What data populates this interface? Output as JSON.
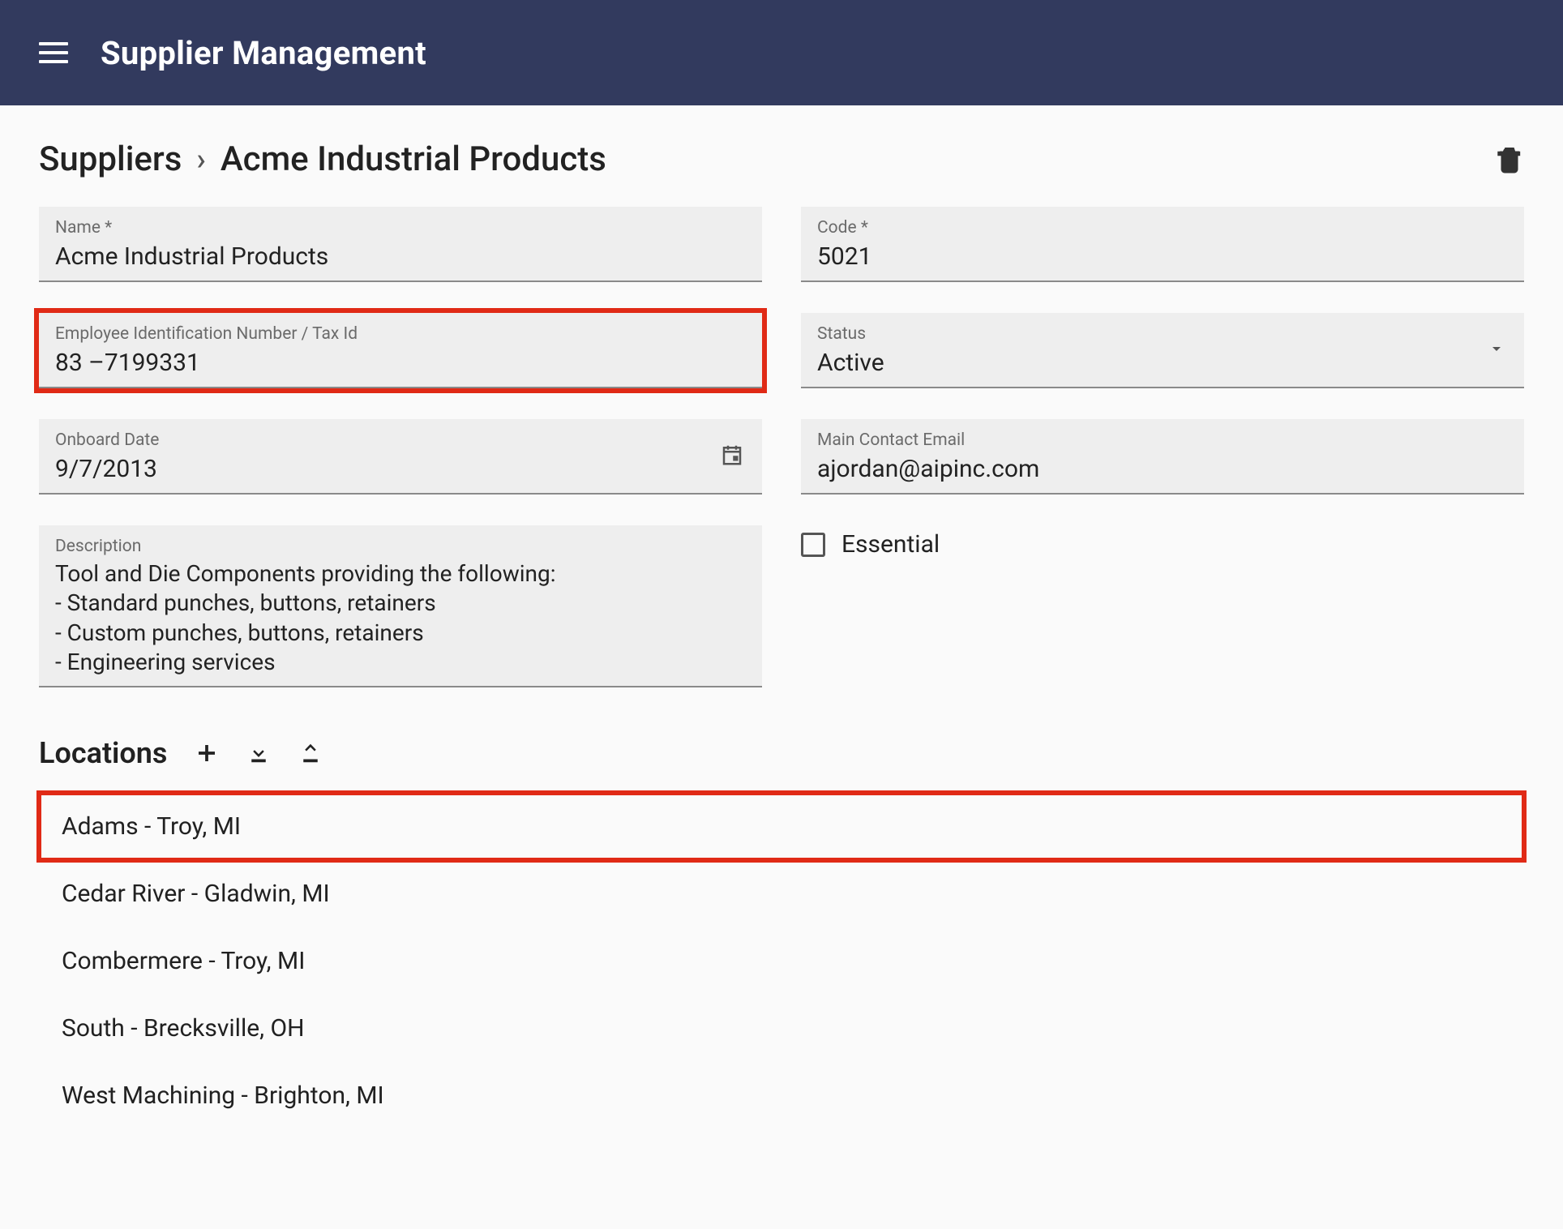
{
  "header": {
    "title": "Supplier Management"
  },
  "breadcrumb": {
    "root": "Suppliers",
    "current": "Acme Industrial Products"
  },
  "fields": {
    "name": {
      "label": "Name *",
      "value": "Acme Industrial Products"
    },
    "code": {
      "label": "Code *",
      "value": "5021"
    },
    "ein": {
      "label": "Employee Identification Number / Tax Id",
      "value": "83 –7199331"
    },
    "status": {
      "label": "Status",
      "value": "Active"
    },
    "onboard": {
      "label": "Onboard Date",
      "value": "9/7/2013"
    },
    "email": {
      "label": "Main Contact Email",
      "value": "ajordan@aipinc.com"
    },
    "description": {
      "label": "Description",
      "value": "Tool and Die Components providing the following:\n- Standard punches, buttons, retainers\n- Custom punches, buttons, retainers\n- Engineering services"
    },
    "essential": {
      "label": "Essential",
      "checked": false
    }
  },
  "locations": {
    "title": "Locations",
    "items": [
      "Adams - Troy, MI",
      "Cedar River - Gladwin, MI",
      "Combermere - Troy, MI",
      "South - Brecksville, OH",
      "West Machining - Brighton, MI"
    ]
  }
}
